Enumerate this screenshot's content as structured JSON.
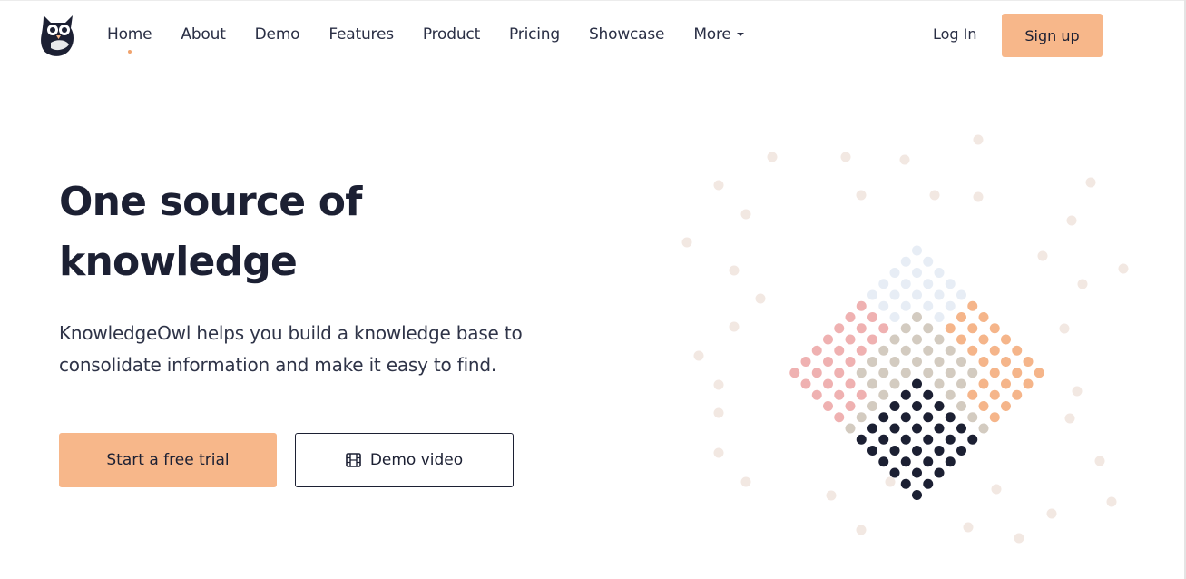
{
  "nav": {
    "items": [
      {
        "label": "Home",
        "active": true
      },
      {
        "label": "About"
      },
      {
        "label": "Demo"
      },
      {
        "label": "Features"
      },
      {
        "label": "Product"
      },
      {
        "label": "Pricing"
      },
      {
        "label": "Showcase"
      },
      {
        "label": "More",
        "dropdown": true
      }
    ],
    "login_label": "Log In",
    "signup_label": "Sign up"
  },
  "hero": {
    "title": "One source of knowledge",
    "lead": "KnowledgeOwl helps you build a knowledge base to consolidate information and make it easy to find.",
    "trial_label": "Start a free trial",
    "demo_label": "Demo video",
    "demo_icon": "film-icon"
  },
  "icons": {
    "logo": "owl-logo-icon",
    "dropdown": "caret-down-icon"
  },
  "colors": {
    "accent": "#f7b78a",
    "text": "#1c2033",
    "dot_pink": "#efb1b1",
    "dot_blue": "#e7edf5",
    "dot_orange": "#f5b58a",
    "dot_gray": "#d3cbc0",
    "dot_navy": "#1c2033",
    "dot_faint": "#f2e8e2"
  }
}
